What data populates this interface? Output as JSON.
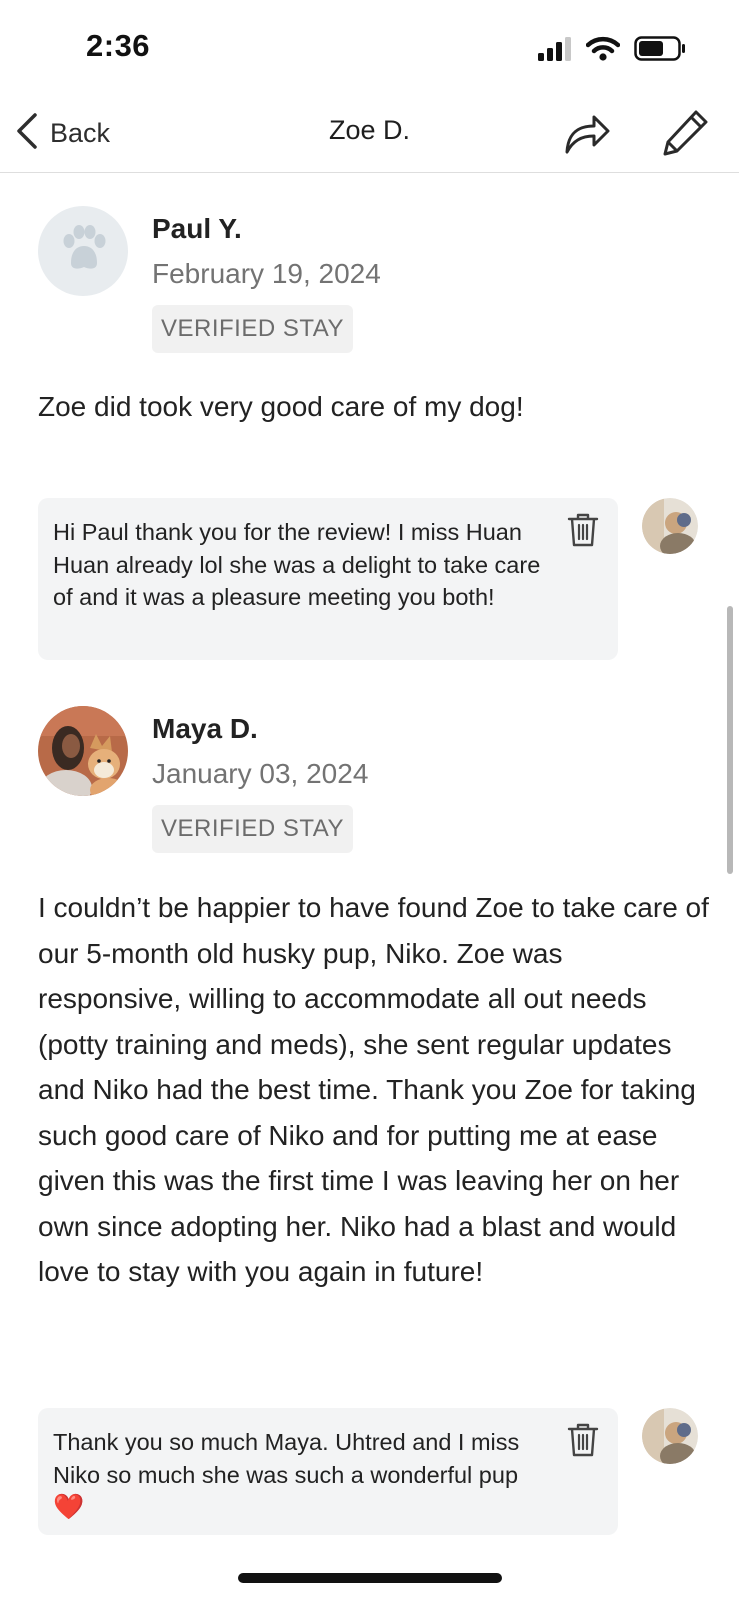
{
  "status_bar": {
    "time": "2:36",
    "icons": [
      "cellular-signal-icon",
      "wifi-icon",
      "battery-icon"
    ]
  },
  "nav": {
    "back_label": "Back",
    "title": "Zoe D.",
    "icons": [
      "chevron-left-icon",
      "share-icon",
      "edit-pencil-icon"
    ]
  },
  "reviews": [
    {
      "name": "Paul Y.",
      "date": "February 19, 2024",
      "badge": "VERIFIED STAY",
      "avatar": "paw-placeholder-avatar",
      "text": "Zoe did took very good care of my dog!",
      "reply": {
        "text": "Hi Paul thank you for the review! I miss Huan Huan already lol she was a delight to take care of and it was a pleasure meeting you both!"
      }
    },
    {
      "name": "Maya D.",
      "date": "January 03, 2024",
      "badge": "VERIFIED STAY",
      "avatar": "photo-avatar",
      "text": "I couldn’t be happier to have found Zoe to take care of our 5-month old husky pup, Niko. Zoe was responsive, willing to accommodate all out needs (potty training and meds), she sent regular updates and Niko had the best time. Thank you Zoe for taking such good care of Niko and for putting me at ease given this was the first time I was leaving her on her own since adopting her. Niko had a blast and would love to stay with you again in future!",
      "reply": {
        "text": "Thank you so much Maya. Uhtred and I miss Niko so much she was such a wonderful pup",
        "emoji": "❤️"
      }
    }
  ],
  "colors": {
    "badge_bg": "#f1f1f1",
    "reply_bg": "#f3f4f5",
    "muted_text": "#737373",
    "heart": "#e0262e"
  }
}
